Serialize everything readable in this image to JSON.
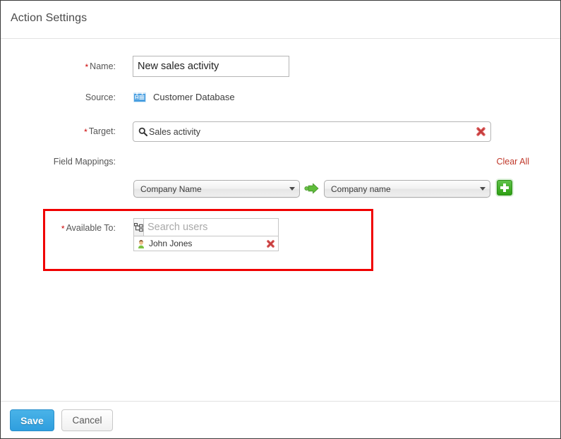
{
  "window": {
    "title": "Action Settings"
  },
  "form": {
    "name": {
      "label": "Name:",
      "required": true,
      "value": "New sales activity"
    },
    "source": {
      "label": "Source:",
      "required": false,
      "icon": "contact-card-icon",
      "value": "Customer Database"
    },
    "target": {
      "label": "Target:",
      "required": true,
      "icon": "search-icon",
      "value": "Sales activity",
      "clear_icon": "red-x-icon"
    },
    "field_mappings": {
      "label": "Field Mappings:",
      "clear_all_label": "Clear All",
      "rows": [
        {
          "source_field": "Company Name",
          "arrow_icon": "green-arrow-right-icon",
          "target_field": "Company name",
          "add_icon": "green-plus-icon"
        }
      ]
    },
    "available_to": {
      "label": "Available To:",
      "required": true,
      "tree_icon": "org-tree-icon",
      "search_placeholder": "Search users",
      "search_value": "",
      "users": [
        {
          "avatar_icon": "user-avatar-icon",
          "name": "John Jones",
          "remove_icon": "red-x-icon"
        }
      ]
    }
  },
  "footer": {
    "save_label": "Save",
    "cancel_label": "Cancel"
  },
  "colors": {
    "required_asterisk": "#cc0000",
    "clear_all_link": "#c0392b",
    "highlight_border": "#f00000",
    "save_button": "#2f9ede",
    "add_button": "#2ea013",
    "source_icon": "#4a9fe0"
  }
}
